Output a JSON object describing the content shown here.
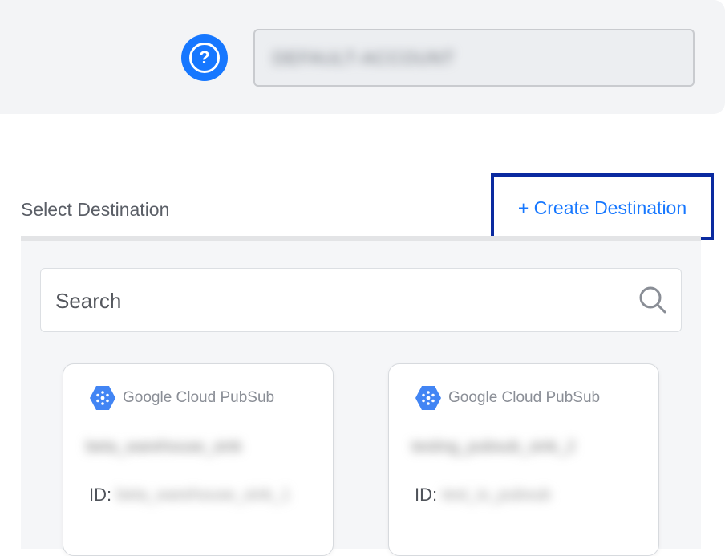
{
  "header": {
    "help_icon_glyph": "?",
    "account_field_value": "DEFAULT-ACCOUNT"
  },
  "destination": {
    "select_label": "Select Destination",
    "create_link_label": "+ Create Destination",
    "accent_color": "#1677ff",
    "highlight_border_color": "#0a2aa0"
  },
  "search": {
    "placeholder": "Search",
    "icon": "search-icon"
  },
  "cards": [
    {
      "provider_label": "Google Cloud PubSub",
      "provider_icon": "google-cloud-pubsub-icon",
      "name": "beta_warehouse_sink",
      "id_label": "ID:",
      "id_value": "beta_warehouse_sink_1"
    },
    {
      "provider_label": "Google Cloud PubSub",
      "provider_icon": "google-cloud-pubsub-icon",
      "name": "testing_pubsub_sink_2",
      "id_label": "ID:",
      "id_value": "test_io_pubsub"
    }
  ]
}
